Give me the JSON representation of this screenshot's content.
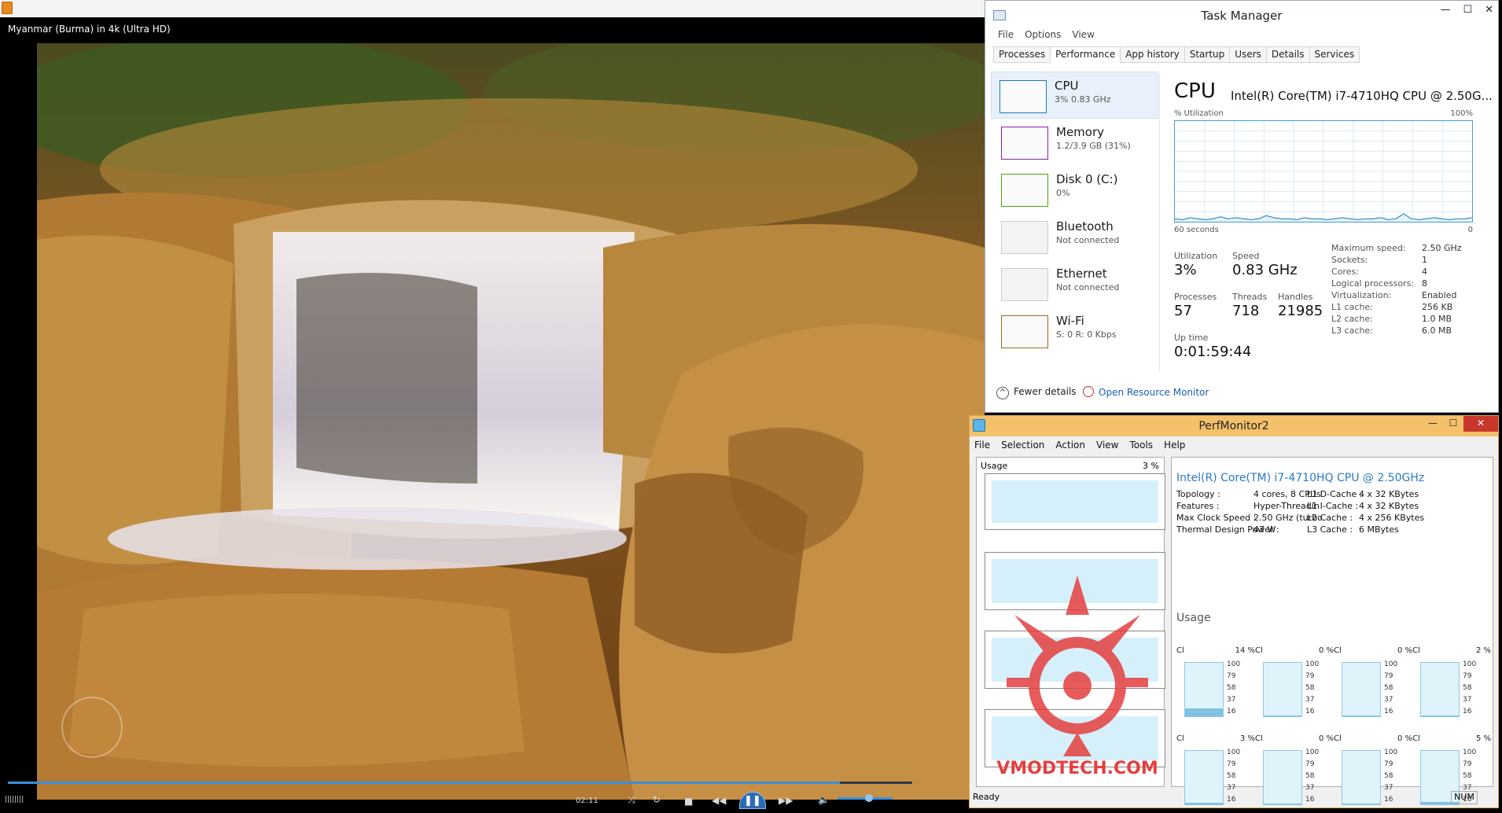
{
  "player": {
    "title": "Myanmar (Burma) in 4k (Ultra HD)",
    "time": "02:11",
    "progress": 0.92,
    "icons": [
      "shuffle-icon",
      "repeat-icon",
      "stop-icon",
      "previous-icon",
      "pause-icon",
      "next-icon",
      "volume-icon"
    ]
  },
  "taskmgr": {
    "title": "Task Manager",
    "menu": [
      "File",
      "Options",
      "View"
    ],
    "tabs": [
      "Processes",
      "Performance",
      "App history",
      "Startup",
      "Users",
      "Details",
      "Services"
    ],
    "active_tab": "Performance",
    "resources": [
      {
        "name": "CPU",
        "sub": "3% 0.83 GHz",
        "color": "#1779ba"
      },
      {
        "name": "Memory",
        "sub": "1.2/3.9 GB (31%)",
        "color": "#8b1fa6"
      },
      {
        "name": "Disk 0 (C:)",
        "sub": "0%",
        "color": "#4da60c"
      },
      {
        "name": "Bluetooth",
        "sub": "Not connected",
        "color": "#aaaaaa"
      },
      {
        "name": "Ethernet",
        "sub": "Not connected",
        "color": "#aaaaaa"
      },
      {
        "name": "Wi-Fi",
        "sub": "S: 0 R: 0 Kbps",
        "color": "#a7661a"
      }
    ],
    "cpu": {
      "heading": "CPU",
      "model": "Intel(R) Core(TM) i7-4710HQ CPU @ 2.50G...",
      "util_label": "% Utilization",
      "max_label": "100%",
      "time_label": "60 seconds",
      "zero_label": "0",
      "stats": {
        "utilization_label": "Utilization",
        "utilization": "3%",
        "speed_label": "Speed",
        "speed": "0.83 GHz",
        "processes_label": "Processes",
        "processes": "57",
        "threads_label": "Threads",
        "threads": "718",
        "handles_label": "Handles",
        "handles": "21985",
        "uptime_label": "Up time",
        "uptime": "0:01:59:44"
      },
      "specs": [
        {
          "k": "Maximum speed:",
          "v": "2.50 GHz"
        },
        {
          "k": "Sockets:",
          "v": "1"
        },
        {
          "k": "Cores:",
          "v": "4"
        },
        {
          "k": "Logical processors:",
          "v": "8"
        },
        {
          "k": "Virtualization:",
          "v": "Enabled"
        },
        {
          "k": "L1 cache:",
          "v": "256 KB"
        },
        {
          "k": "L2 cache:",
          "v": "1.0 MB"
        },
        {
          "k": "L3 cache:",
          "v": "6.0 MB"
        }
      ],
      "utilization_history": [
        3,
        2,
        4,
        3,
        2,
        3,
        5,
        3,
        4,
        3,
        2,
        3,
        6,
        4,
        3,
        3,
        2,
        4,
        3,
        3,
        2,
        3,
        4,
        3,
        2,
        3,
        3,
        4,
        2,
        3,
        8,
        3,
        2,
        3,
        4,
        3,
        2,
        3,
        3,
        4
      ]
    },
    "footer": {
      "fewer": "Fewer details",
      "resmon": "Open Resource Monitor"
    }
  },
  "perfmon": {
    "title": "PerfMonitor2",
    "menu": [
      "File",
      "Selection",
      "Action",
      "View",
      "Tools",
      "Help"
    ],
    "usage_label": "Usage",
    "usage_pct": "3 %",
    "cpu_name": "Intel(R) Core(TM) i7-4710HQ CPU @ 2.50GHz",
    "info_left": [
      {
        "k": "Topology :",
        "v": "4 cores, 8 CPUs"
      },
      {
        "k": "Features :",
        "v": "Hyper-Threadin"
      },
      {
        "k": "Max Clock Speed :",
        "v": "2.50 GHz (turbo"
      },
      {
        "k": "Thermal Design Power :",
        "v": "47 W"
      }
    ],
    "info_right": [
      {
        "k": "L1 D-Cache :",
        "v": "4 x 32 KBytes"
      },
      {
        "k": "L1 I-Cache :",
        "v": "4 x 32 KBytes"
      },
      {
        "k": "L2 Cache :",
        "v": "4 x 256 KBytes"
      },
      {
        "k": "L3 Cache :",
        "v": "6 MBytes"
      }
    ],
    "usage_heading": "Usage",
    "cores": [
      {
        "label": "Cl",
        "pct": "14 %",
        "level": 0.14
      },
      {
        "label": "Cl",
        "pct": "0 %",
        "level": 0.0
      },
      {
        "label": "Cl",
        "pct": "0 %",
        "level": 0.0
      },
      {
        "label": "Cl",
        "pct": "2 %",
        "level": 0.02
      },
      {
        "label": "Cl",
        "pct": "3 %",
        "level": 0.03
      },
      {
        "label": "Cl",
        "pct": "0 %",
        "level": 0.0
      },
      {
        "label": "Cl",
        "pct": "0 %",
        "level": 0.0
      },
      {
        "label": "Cl",
        "pct": "5 %",
        "level": 0.05
      }
    ],
    "ticks": [
      "100",
      "79",
      "58",
      "37",
      "16"
    ],
    "status": "Ready",
    "num": "NUM"
  },
  "watermark": {
    "text": "VMODTECH.COM"
  }
}
